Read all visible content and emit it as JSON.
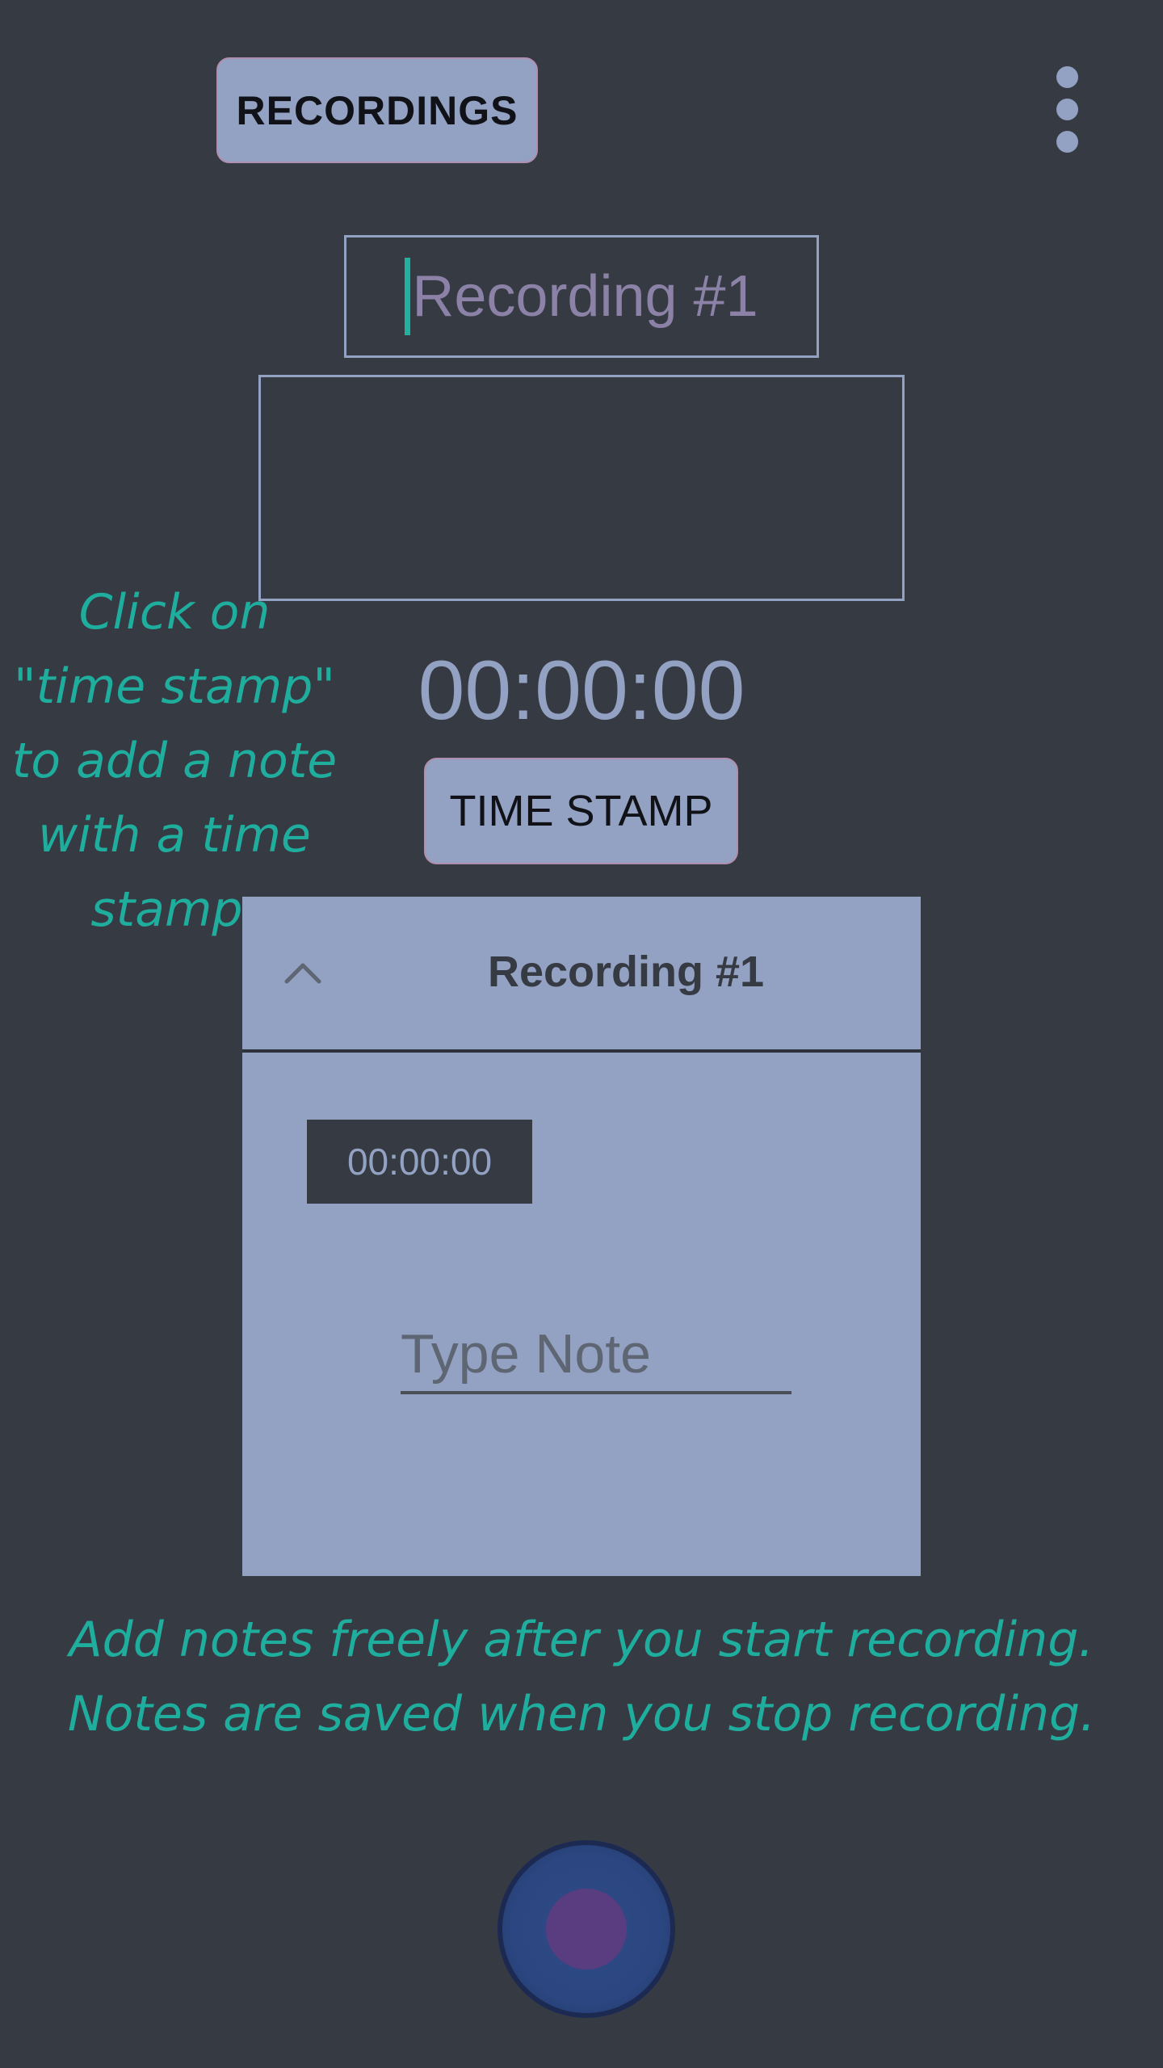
{
  "toolbar": {
    "recordings_label": "RECORDINGS",
    "overflow_icon": "more-vert-icon"
  },
  "recording_title": {
    "placeholder": "Recording #1",
    "value": ""
  },
  "hints": {
    "time_stamp": "Click on\n\"time stamp\"\nto add a note\nwith a time\nstamp.",
    "notes": "Add notes freely after you start recording.\nNotes are saved when you stop recording."
  },
  "timer": {
    "value": "00:00:00"
  },
  "time_stamp_button": {
    "label": "TIME STAMP"
  },
  "note_card": {
    "title": "Recording #1",
    "collapse_icon": "chevron-up-icon",
    "stamp": "00:00:00",
    "note_placeholder": "Type Note"
  },
  "record_button": {
    "icon": "record-icon"
  },
  "colors": {
    "background": "#363a43",
    "accent": "#93a1c2",
    "hint_text": "#1fae9e",
    "record_button": "#2f4a86",
    "record_dot": "#5a3d80"
  }
}
